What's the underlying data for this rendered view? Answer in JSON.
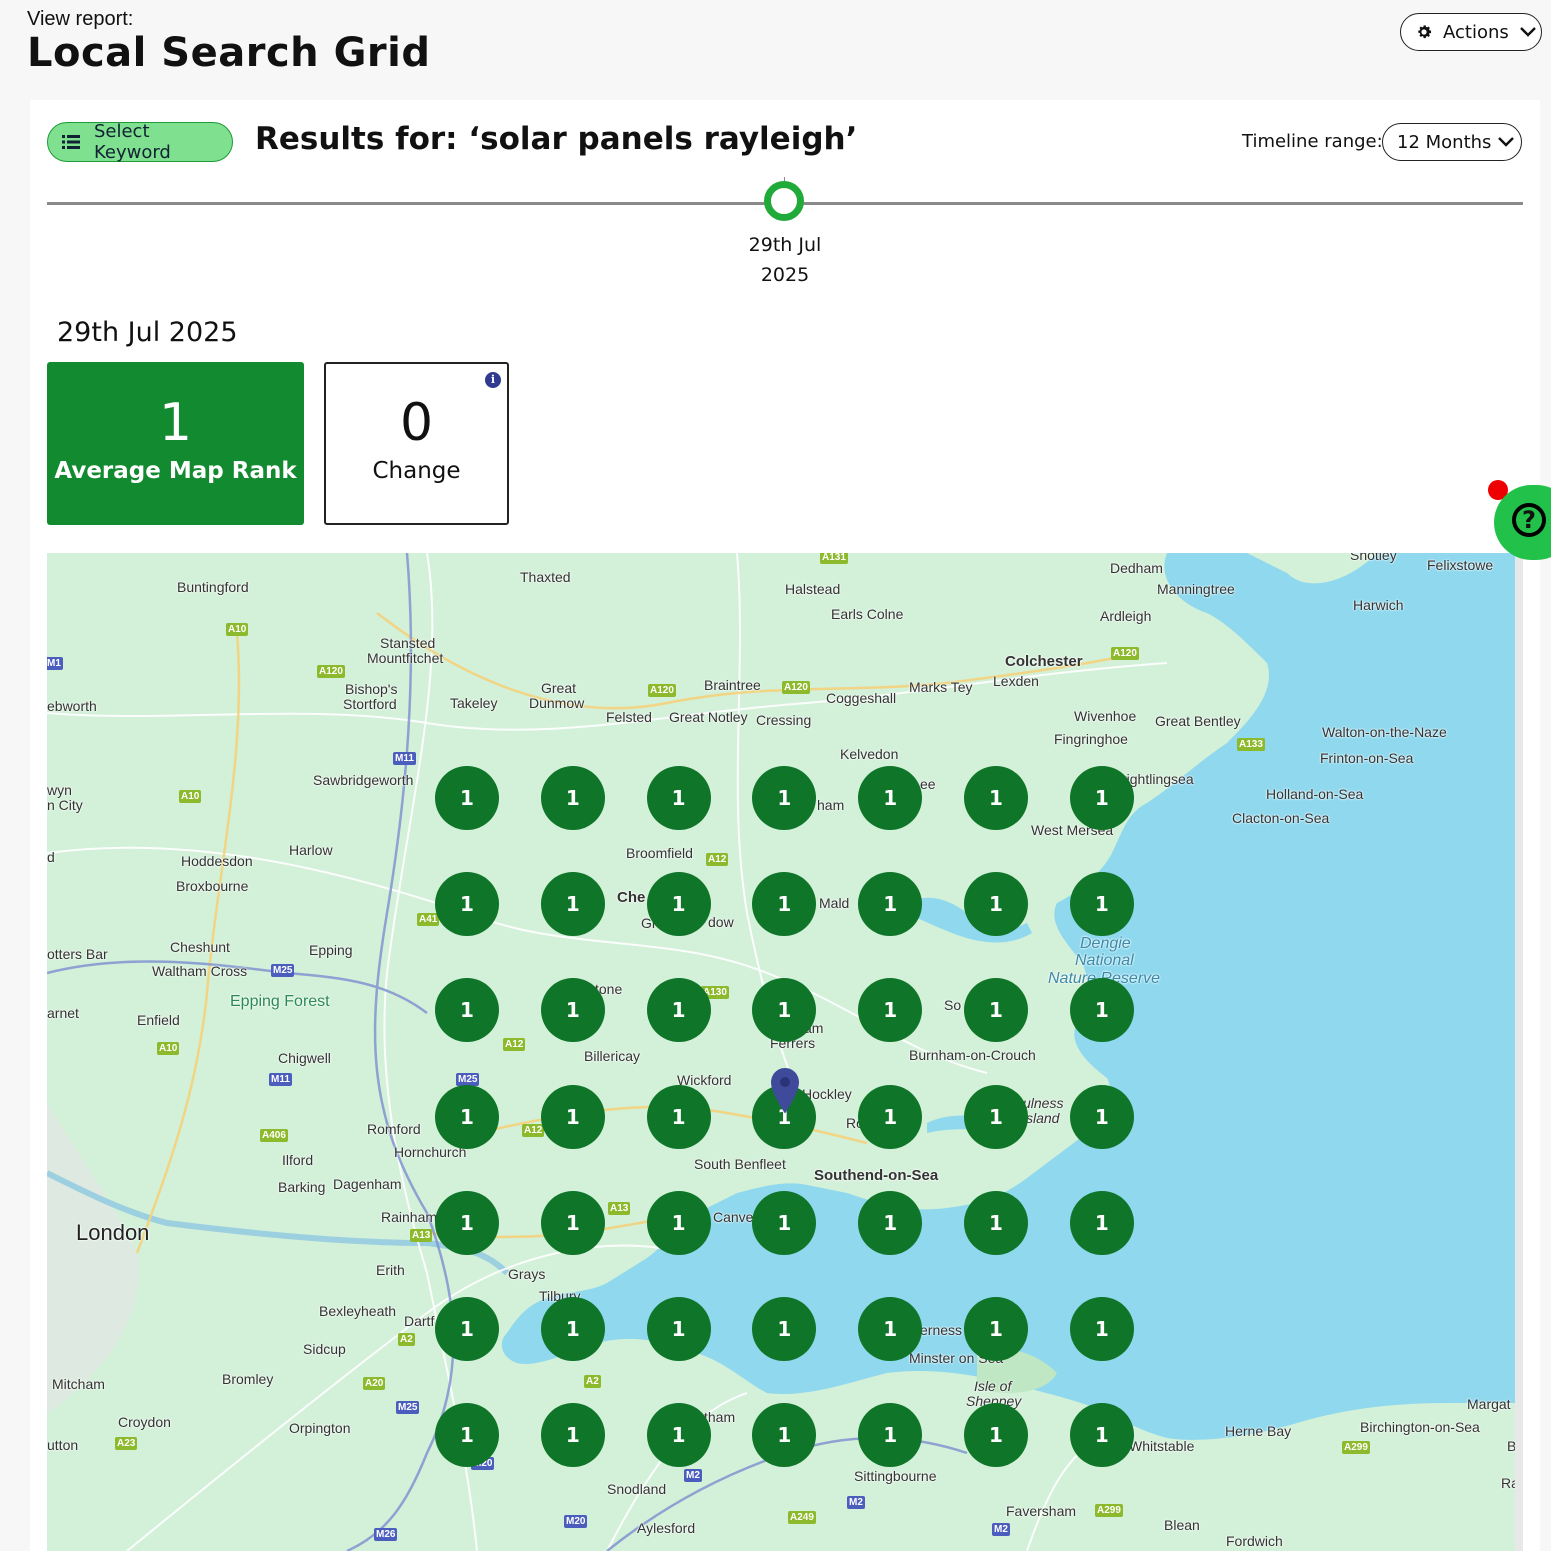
{
  "header": {
    "subtitle": "View report:",
    "title": "Local Search Grid",
    "actions_label": "Actions"
  },
  "toolbar": {
    "select_keyword_label": "Select Keyword",
    "results_title": "Results for: ‘solar panels rayleigh’",
    "timeline_label": "Timeline range:",
    "timeline_value": "12 Months"
  },
  "timeline": {
    "point_line1": "29th Jul",
    "point_line2": "2025"
  },
  "report_date": "29th Jul 2025",
  "stats": {
    "average_rank_value": "1",
    "average_rank_label": "Average Map Rank",
    "change_value": "0",
    "change_label": "Change",
    "info_icon": "i"
  },
  "help": {
    "icon": "?"
  },
  "colors": {
    "accent": "#128a30",
    "grid_point": "#0f7528",
    "keyword_button": "#7fe08f",
    "knob": "#1faa3a",
    "pin": "#3f4b9a"
  },
  "map": {
    "grid_rows": 7,
    "grid_cols": 7,
    "ranks": [
      [
        "1",
        "1",
        "1",
        "1",
        "1",
        "1",
        "1"
      ],
      [
        "1",
        "1",
        "1",
        "1",
        "1",
        "1",
        "1"
      ],
      [
        "1",
        "1",
        "1",
        "1",
        "1",
        "1",
        "1"
      ],
      [
        "1",
        "1",
        "1",
        "1",
        "1",
        "1",
        "1"
      ],
      [
        "1",
        "1",
        "1",
        "1",
        "1",
        "1",
        "1"
      ],
      [
        "1",
        "1",
        "1",
        "1",
        "1",
        "1",
        "1"
      ],
      [
        "1",
        "1",
        "1",
        "1",
        "1",
        "1",
        "1"
      ]
    ],
    "places": [
      "Buntingford",
      "Thaxted",
      "Halstead",
      "Earls Colne",
      "Dedham",
      "Manningtree",
      "Felixstowe",
      "Harwich",
      "Ardleigh",
      "Stansted",
      "Mountfitchet",
      "Bishop's",
      "Stortford",
      "Takeley",
      "Great",
      "Dunmow",
      "Felsted",
      "Braintree",
      "Great Notley",
      "Cressing",
      "Coggeshall",
      "Marks Tey",
      "Colchester",
      "Lexden",
      "Wivenhoe",
      "Fingringhoe",
      "Great Bentley",
      "Walton-on-the-Naze",
      "Frinton-on-Sea",
      "Holland-on-Sea",
      "Clacton-on-Sea",
      "ebworth",
      "Sawbridgeworth",
      "Kelvedon",
      "rightlingsea",
      "West Mersea",
      "wyn",
      "n City",
      "Harlow",
      "Hoddesdon",
      "Broxbourne",
      "Broomfield",
      "Che",
      "Gr",
      "dow",
      "Mald",
      "Dengie",
      "National",
      "Nature Reserve",
      "otters Bar",
      "Cheshunt",
      "Waltham Cross",
      "Epping",
      "Epping Forest",
      "arnet",
      "Enfield",
      "tone",
      "am",
      "Ferrers",
      "So",
      "Burnham-on-Crouch",
      "Billericay",
      "Chigwell",
      "Wickford",
      "Hockley",
      "Ro",
      "ulness",
      "sland",
      "Romford",
      "Hornchurch",
      "South Benfleet",
      "Southend-on-Sea",
      "Ilford",
      "Barking",
      "Dagenham",
      "London",
      "Rainham",
      "Canve",
      "Erith",
      "Grays",
      "Tilbury",
      "Bexleyheath",
      "Dartf",
      "erness",
      "Minster on Sea",
      "Sidcup",
      "Mitcham",
      "Bromley",
      "Isle of",
      "Sheppey",
      "Margat",
      "Croydon",
      "Orpington",
      "tham",
      "Herne Bay",
      "Birchington-on-Sea",
      "Whitstable",
      "utton",
      "Sittingbourne",
      "Snodland",
      "Faversham",
      "Aylesford",
      "Blean",
      "Fordwich",
      "Br",
      "Rar",
      "Shotley",
      "d",
      "ham",
      "ee"
    ],
    "roads": [
      "A131",
      "A10",
      "A120",
      "A120",
      "A120",
      "A120",
      "M11",
      "A10",
      "A133",
      "A12",
      "A41",
      "M25",
      "A130",
      "A10",
      "A12",
      "M11",
      "M25",
      "A406",
      "A12",
      "A13",
      "A13",
      "A2",
      "A20",
      "A2",
      "M25",
      "A23",
      "M20",
      "M2",
      "A249",
      "M2",
      "A299",
      "A299",
      "M26",
      "M20",
      "M2",
      "M1"
    ]
  }
}
